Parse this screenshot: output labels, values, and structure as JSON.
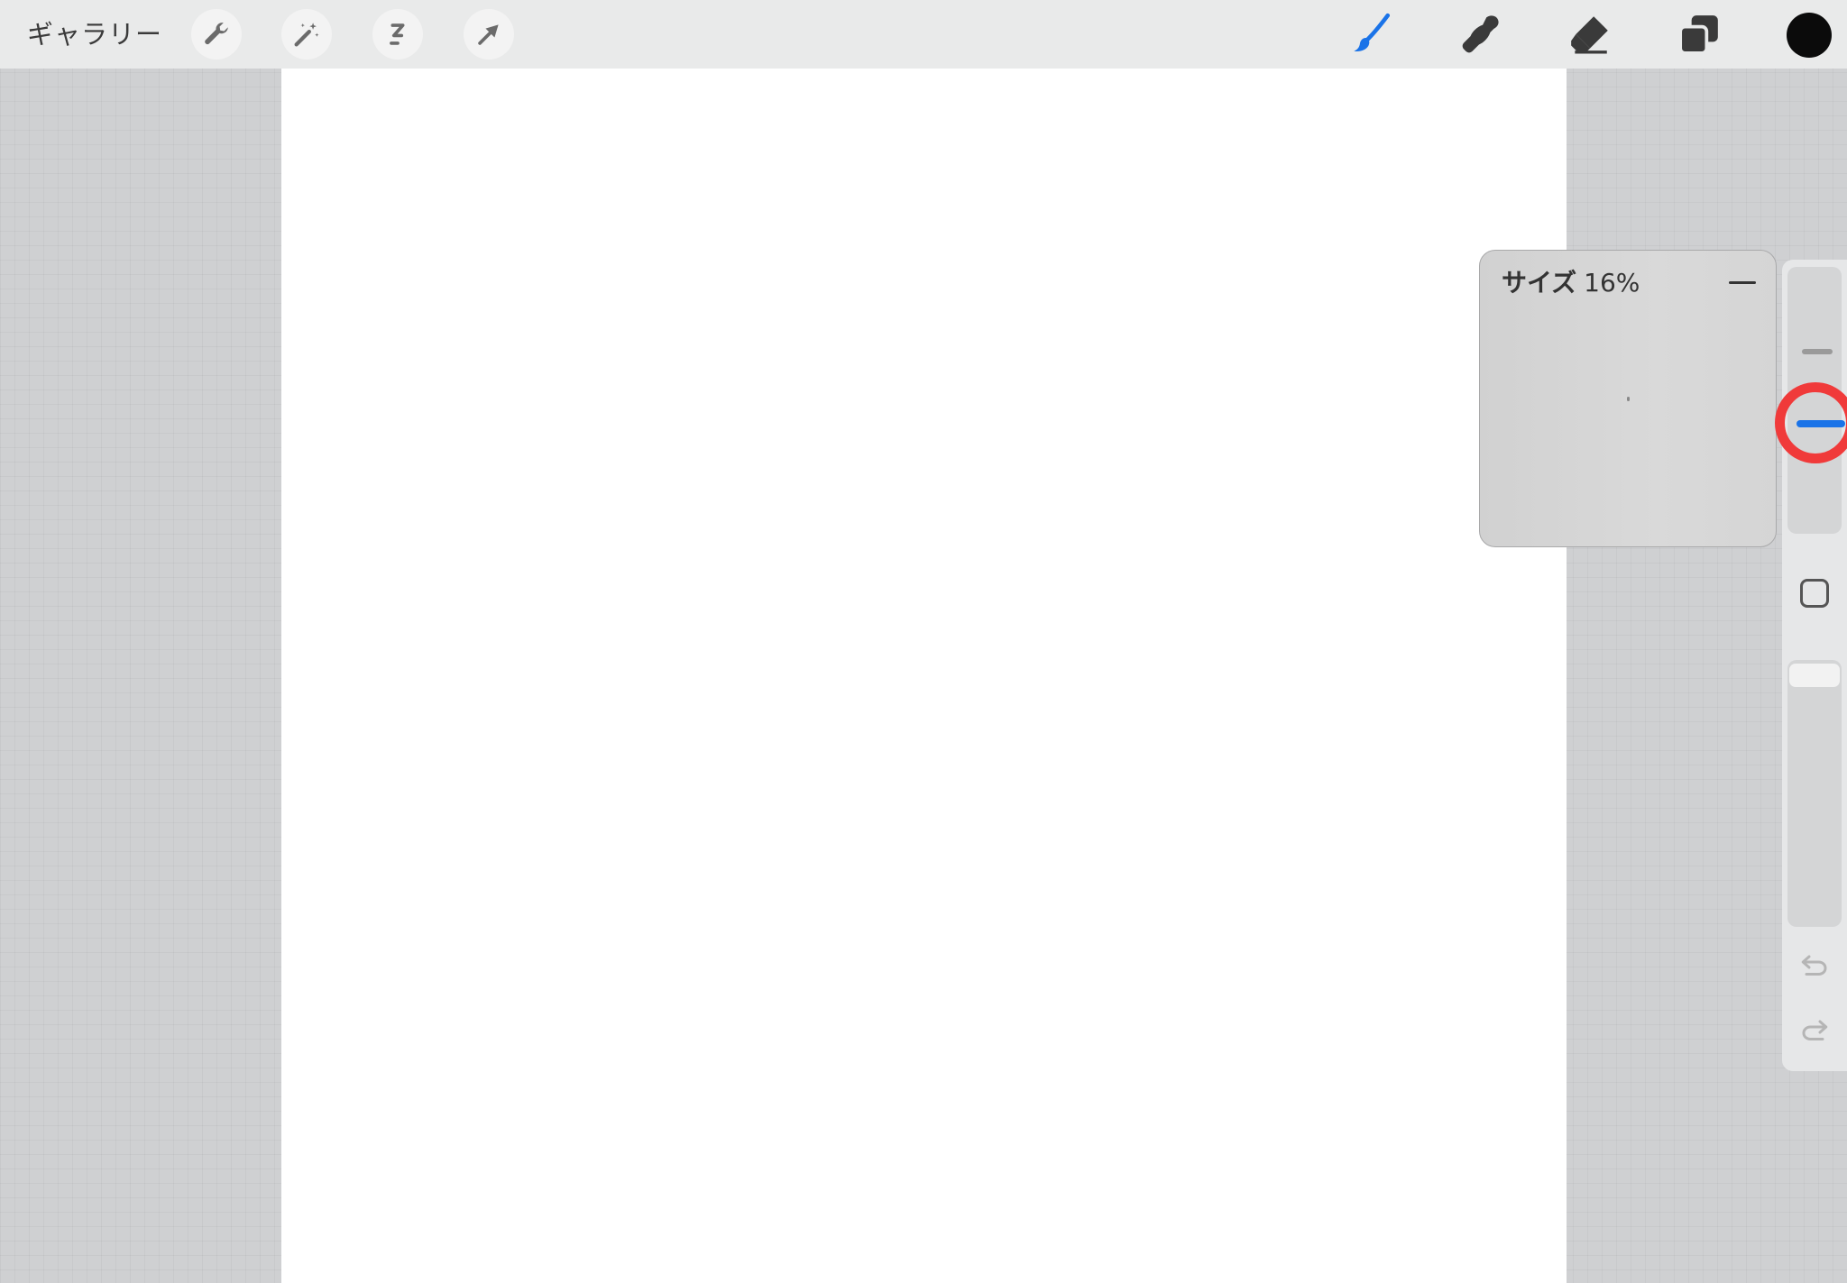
{
  "topbar": {
    "gallery_label": "ギャラリー",
    "left_tools": [
      "wrench-icon",
      "magic-wand-icon",
      "selection-icon",
      "transform-arrow-icon"
    ],
    "right_tools": [
      "brush-icon",
      "smudge-icon",
      "eraser-icon",
      "layers-icon"
    ],
    "active_tool": "brush",
    "accent_color": "#1a73e8",
    "current_color": "#0b0b0b"
  },
  "size_popup": {
    "label": "サイズ",
    "value": "16%"
  },
  "sidebar": {
    "highlight_color": "#f03a3a",
    "controls": [
      "brush-size-slider",
      "modify-button",
      "opacity-slider",
      "undo-button",
      "redo-button"
    ]
  }
}
